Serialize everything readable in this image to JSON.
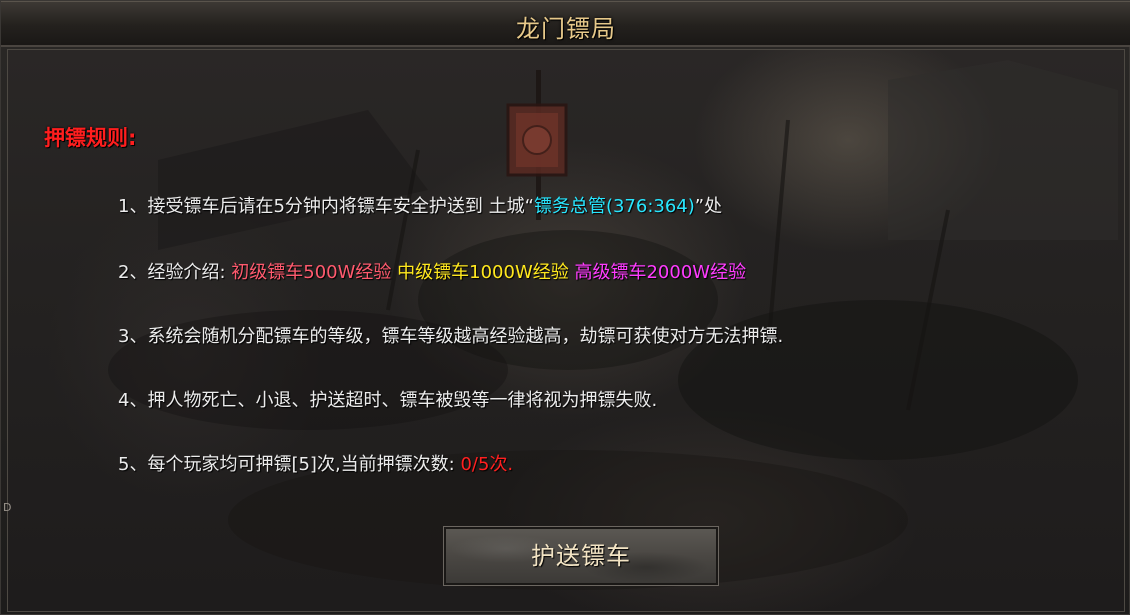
{
  "window": {
    "title": "龙门镖局"
  },
  "rules": {
    "heading": "押镖规则:",
    "r1": {
      "prefix": "1、接受镖车后请在5分钟内将镖车安全护送到 土城“",
      "target": "镖务总管(376:364)",
      "suffix": "”处"
    },
    "r2": {
      "prefix": "2、经验介绍: ",
      "low": "初级镖车500W经验",
      "mid": "中级镖车1000W经验",
      "high": "高级镖车2000W经验"
    },
    "r3": {
      "text": "3、系统会随机分配镖车的等级，镖车等级越高经验越高，劫镖可获使对方无法押镖."
    },
    "r4": {
      "text": "4、押人物死亡、小退、护送超时、镖车被毁等一律将视为押镖失败."
    },
    "r5": {
      "prefix": "5、每个玩家均可押镖[5]次,当前押镖次数: ",
      "count": "0/5次."
    }
  },
  "actions": {
    "escort_label": "护送镖车"
  },
  "side": {
    "edge_letter": "D"
  },
  "colors": {
    "title": "#e7c98a",
    "heading": "#ff1e1e",
    "npc_link": "#28e6ff",
    "low_tier": "#ff5a6e",
    "mid_tier": "#ffe81e",
    "high_tier": "#ff3cff",
    "count": "#ff2020"
  }
}
